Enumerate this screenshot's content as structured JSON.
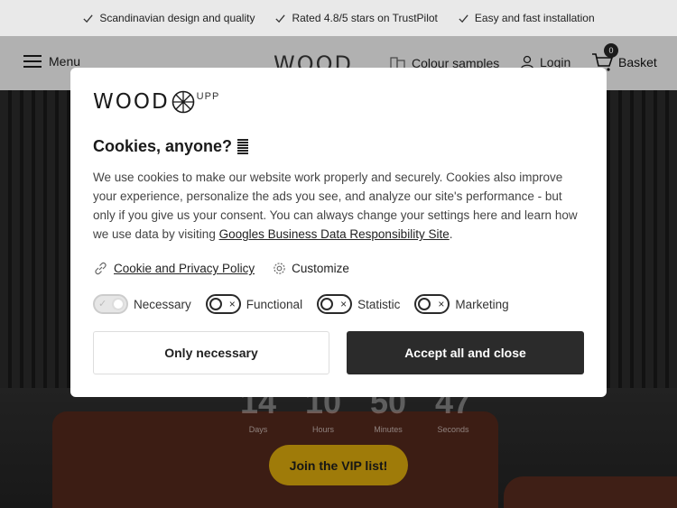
{
  "usp_bar": {
    "items": [
      {
        "text": "Scandinavian design and quality",
        "icon": "check-icon"
      },
      {
        "text": "Rated 4.8/5 stars on TrustPilot",
        "icon": "check-icon"
      },
      {
        "text": "Easy and fast installation",
        "icon": "check-icon"
      }
    ]
  },
  "header": {
    "menu_label": "Menu",
    "logo_text": "WOOD",
    "colour_samples_label": "Colour samples",
    "login_label": "Login",
    "basket_label": "Basket",
    "basket_count": "0"
  },
  "hero": {
    "countdown": [
      {
        "value": "14",
        "label": "Days"
      },
      {
        "value": "10",
        "label": "Hours"
      },
      {
        "value": "50",
        "label": "Minutes"
      },
      {
        "value": "47",
        "label": "Seconds"
      }
    ],
    "cta_label": "Join the VIP list!"
  },
  "cookie_modal": {
    "logo_main": "WOOD",
    "logo_suffix": "UPP",
    "title": "Cookies, anyone?",
    "body_text": "We use cookies to make our website work properly and securely. Cookies also improve your experience, personalize the ads you see, and analyze our site's performance - but only if you give us your consent. You can always change your settings here and learn how we use data by visiting ",
    "body_link": "Googles Business Data Responsibility Site",
    "body_end": ".",
    "policy_link": "Cookie and Privacy Policy",
    "customize_label": "Customize",
    "toggles": [
      {
        "label": "Necessary",
        "state": "on-locked"
      },
      {
        "label": "Functional",
        "state": "off"
      },
      {
        "label": "Statistic",
        "state": "off"
      },
      {
        "label": "Marketing",
        "state": "off"
      }
    ],
    "only_necessary_label": "Only necessary",
    "accept_all_label": "Accept all and close"
  },
  "colors": {
    "accent_gold": "#c2960c",
    "dark_button": "#2b2b2b"
  }
}
